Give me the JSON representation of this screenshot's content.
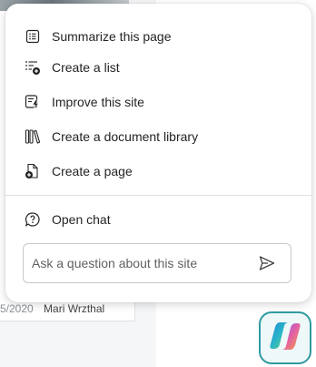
{
  "menu": {
    "items": [
      {
        "label": "Summarize this page",
        "icon": "summary-list-icon"
      },
      {
        "label": "Create a list",
        "icon": "add-list-icon"
      },
      {
        "label": "Improve this site",
        "icon": "improve-site-icon"
      },
      {
        "label": "Create a document library",
        "icon": "library-icon"
      },
      {
        "label": "Create a page",
        "icon": "add-page-icon"
      }
    ],
    "open_chat_label": "Open chat"
  },
  "ask": {
    "placeholder": "Ask a question about this site"
  },
  "background": {
    "row_date": "5/2020",
    "row_author": "Mari Wrzthal"
  },
  "colors": {
    "text": "#242424",
    "accent": "#2f9aa0"
  }
}
